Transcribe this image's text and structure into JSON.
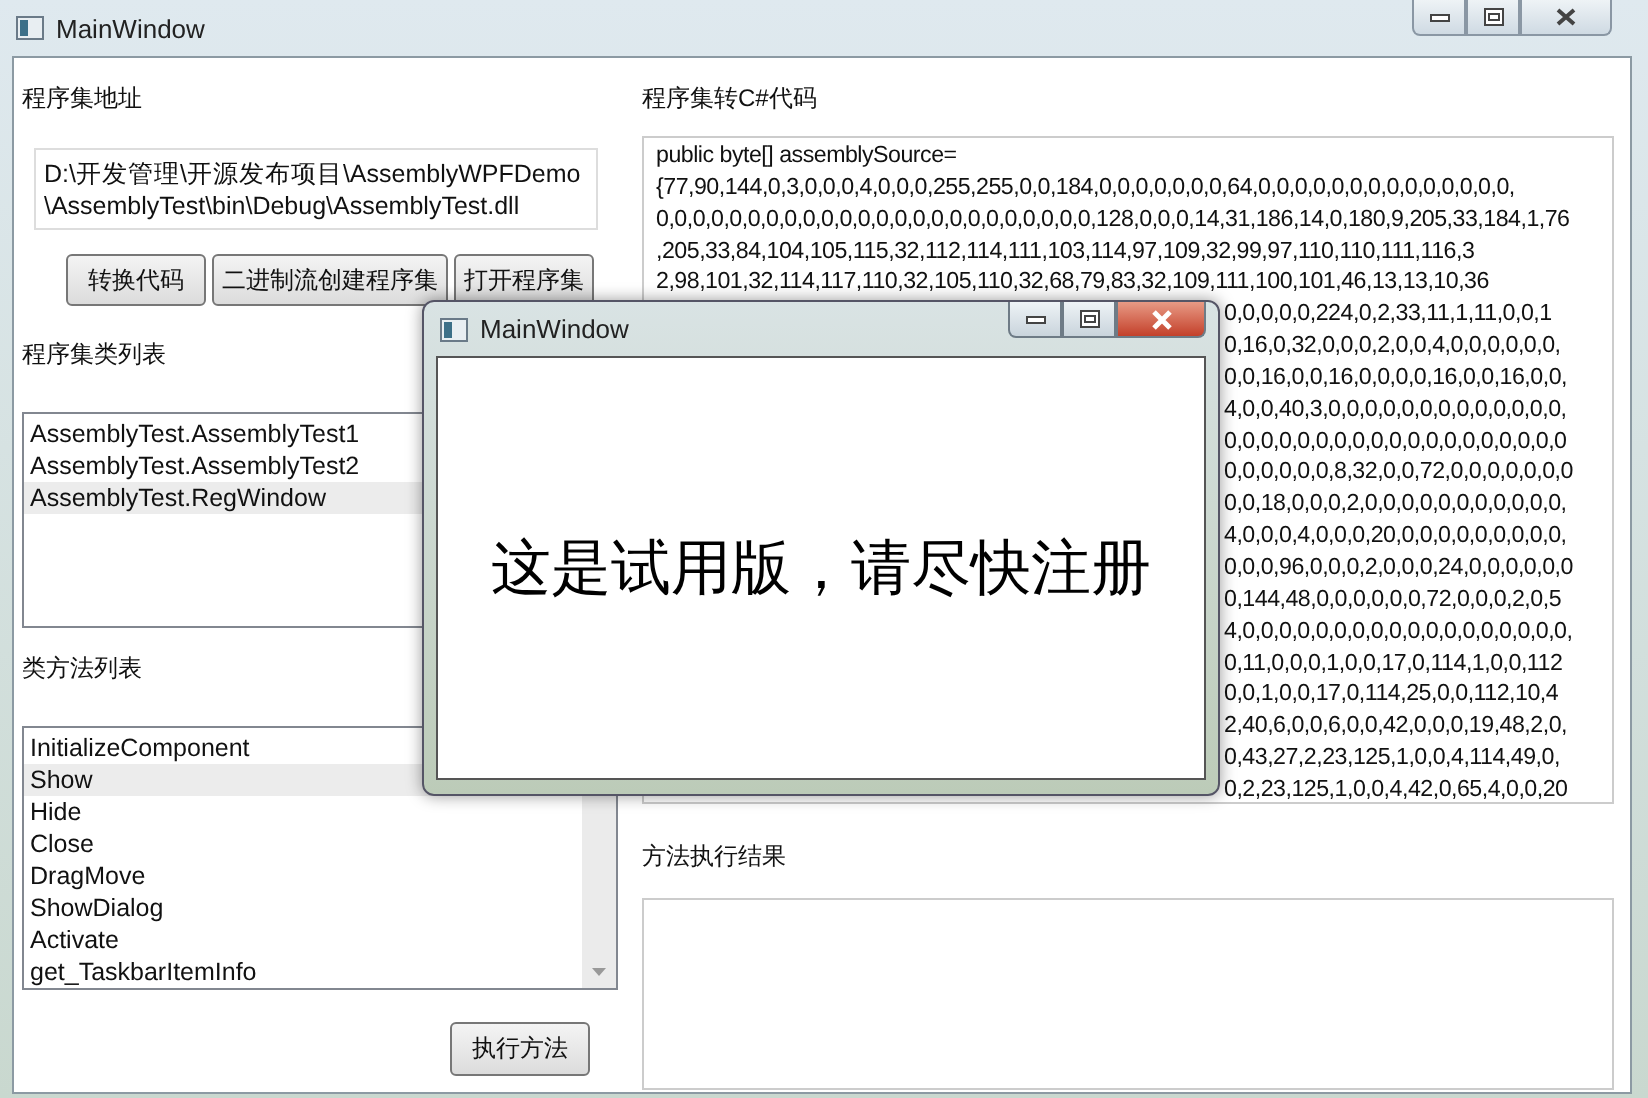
{
  "window": {
    "title": "MainWindow"
  },
  "left": {
    "path_label": "程序集地址",
    "path_value": "D:\\开发管理\\开源发布项目\\AssemblyWPFDemo\n\\AssemblyTest\\bin\\Debug\\AssemblyTest.dll",
    "buttons": [
      "转换代码",
      "二进制流创建程序集",
      "打开程序集"
    ],
    "classes_label": "程序集类列表",
    "classes": [
      {
        "label": "AssemblyTest.AssemblyTest1",
        "selected": false
      },
      {
        "label": "AssemblyTest.AssemblyTest2",
        "selected": false
      },
      {
        "label": "AssemblyTest.RegWindow",
        "selected": true
      }
    ],
    "methods_label": "类方法列表",
    "methods": [
      {
        "label": "InitializeComponent",
        "selected": false
      },
      {
        "label": "Show",
        "selected": true
      },
      {
        "label": "Hide",
        "selected": false
      },
      {
        "label": "Close",
        "selected": false
      },
      {
        "label": "DragMove",
        "selected": false
      },
      {
        "label": "ShowDialog",
        "selected": false
      },
      {
        "label": "Activate",
        "selected": false
      },
      {
        "label": "get_TaskbarItemInfo",
        "selected": false
      }
    ],
    "run_button": "执行方法"
  },
  "right": {
    "code_label": "程序集转C#代码",
    "code_lines": [
      {
        "kind": "full",
        "text": "public byte[] assemblySource="
      },
      {
        "kind": "full",
        "text": "{77,90,144,0,3,0,0,0,4,0,0,0,255,255,0,0,184,0,0,0,0,0,0,0,64,0,0,0,0,0,0,0,0,0,0,0,0,0,0,"
      },
      {
        "kind": "full",
        "text": "0,0,0,0,0,0,0,0,0,0,0,0,0,0,0,0,0,0,0,0,0,0,0,0,128,0,0,0,14,31,186,14,0,180,9,205,33,184,1,76"
      },
      {
        "kind": "full",
        "text": ",205,33,84,104,105,115,32,112,114,111,103,114,97,109,32,99,97,110,110,111,116,3"
      },
      {
        "kind": "full",
        "text": "2,98,101,32,114,117,110,32,105,110,32,68,79,83,32,109,111,100,101,46,13,13,10,36"
      },
      {
        "kind": "partial",
        "text": "0,0,0,0,0,224,0,2,33,11,1,11,0,0,1"
      },
      {
        "kind": "partial",
        "text": "0,16,0,32,0,0,0,2,0,0,4,0,0,0,0,0,0,"
      },
      {
        "kind": "partial",
        "text": "0,0,16,0,0,16,0,0,0,0,16,0,0,16,0,0,"
      },
      {
        "kind": "partial",
        "text": "4,0,0,40,3,0,0,0,0,0,0,0,0,0,0,0,0,0,"
      },
      {
        "kind": "partial",
        "text": "0,0,0,0,0,0,0,0,0,0,0,0,0,0,0,0,0,0,0"
      },
      {
        "kind": "partial",
        "text": "0,0,0,0,0,0,8,32,0,0,72,0,0,0,0,0,0,0"
      },
      {
        "kind": "partial",
        "text": "0,0,18,0,0,0,2,0,0,0,0,0,0,0,0,0,0,0,"
      },
      {
        "kind": "partial",
        "text": "4,0,0,0,4,0,0,0,20,0,0,0,0,0,0,0,0,0,"
      },
      {
        "kind": "partial",
        "text": "0,0,0,96,0,0,0,2,0,0,0,24,0,0,0,0,0,0"
      },
      {
        "kind": "partial",
        "text": "0,144,48,0,0,0,0,0,0,72,0,0,0,2,0,5"
      },
      {
        "kind": "partial",
        "text": "4,0,0,0,0,0,0,0,0,0,0,0,0,0,0,0,0,0,0,"
      },
      {
        "kind": "partial",
        "text": "0,11,0,0,0,1,0,0,17,0,114,1,0,0,112"
      },
      {
        "kind": "partial",
        "text": "0,0,1,0,0,17,0,114,25,0,0,112,10,4"
      },
      {
        "kind": "partial",
        "text": "2,40,6,0,0,6,0,0,42,0,0,0,19,48,2,0,"
      },
      {
        "kind": "partial",
        "text": "0,43,27,2,23,125,1,0,0,4,114,49,0,"
      },
      {
        "kind": "partial",
        "text": "0,2,23,125,1,0,0,4,42,0,65,4,0,0,20"
      }
    ],
    "result_label": "方法执行结果"
  },
  "dialog": {
    "title": "MainWindow",
    "message": "这是试用版，请尽快注册"
  }
}
